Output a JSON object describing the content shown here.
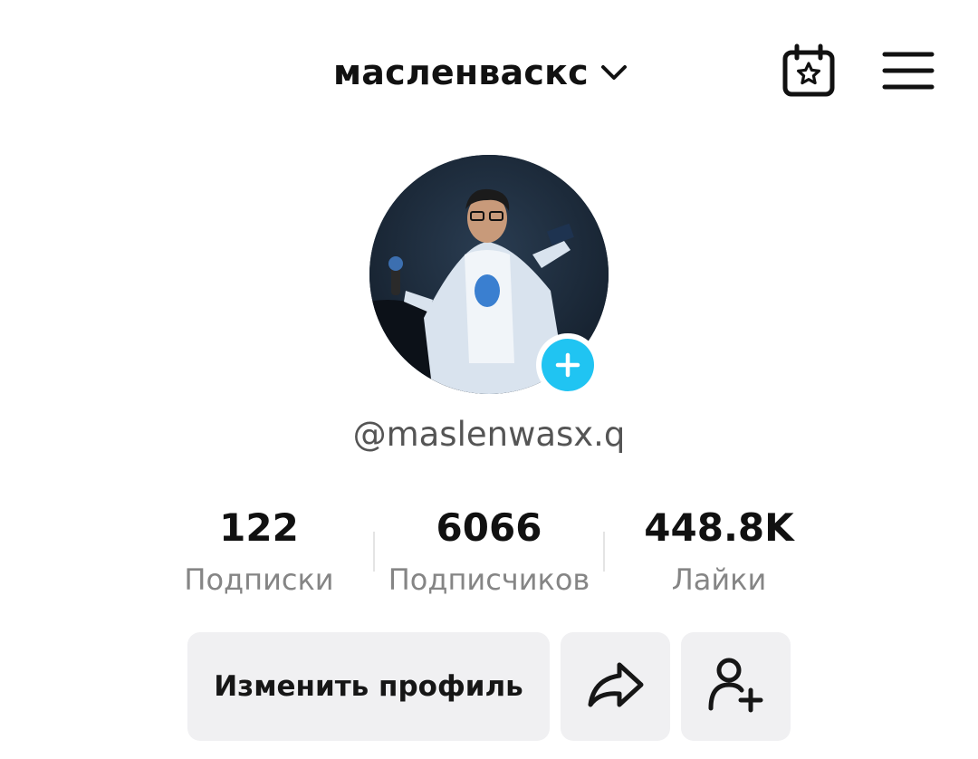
{
  "header": {
    "title": "масленваскс",
    "chevron_icon": "chevron-down-icon",
    "calendar_icon": "calendar-star-icon",
    "menu_icon": "hamburger-menu-icon"
  },
  "profile": {
    "avatar_icon": "profile-photo",
    "add_icon": "plus-icon",
    "accent_color": "#20c4f2",
    "username": "@maslenwasx.q"
  },
  "stats": [
    {
      "value": "122",
      "label": "Подписки"
    },
    {
      "value": "6066",
      "label": "Подписчиков"
    },
    {
      "value": "448.8K",
      "label": "Лайки"
    }
  ],
  "actions": {
    "edit_label": "Изменить профиль",
    "share_icon": "share-arrow-icon",
    "add_friend_icon": "add-friend-icon"
  }
}
